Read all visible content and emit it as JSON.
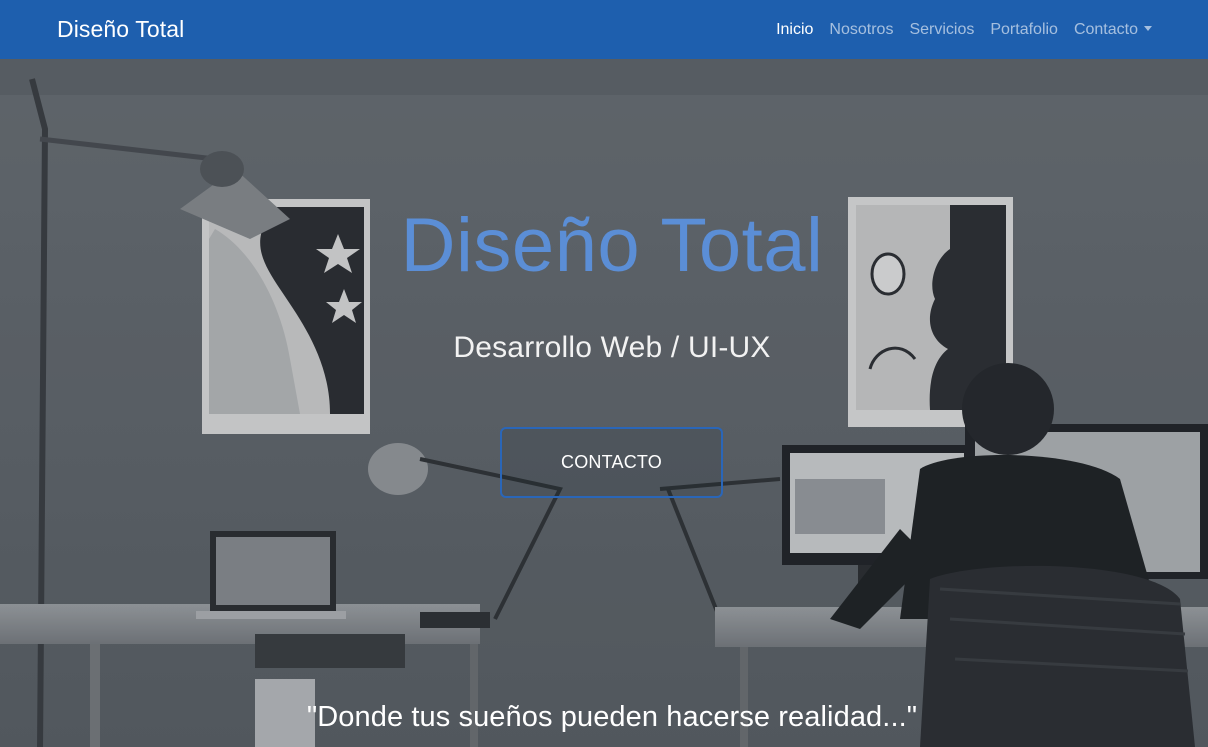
{
  "navbar": {
    "brand": "Diseño Total",
    "links": [
      {
        "label": "Inicio"
      },
      {
        "label": "Nosotros"
      },
      {
        "label": "Servicios"
      },
      {
        "label": "Portafolio"
      },
      {
        "label": "Contacto"
      }
    ]
  },
  "hero": {
    "title": "Diseño Total",
    "subtitle": "Desarrollo Web / UI-UX",
    "button_label": "CONTACTO",
    "quote": "\"Donde tus sueños pueden hacerse realidad...\""
  },
  "colors": {
    "navbar_bg": "#1e5fae",
    "title_blue": "#5b8ed6",
    "button_border": "#2a66b8"
  },
  "icons": {
    "dropdown": "caret-down-icon"
  }
}
